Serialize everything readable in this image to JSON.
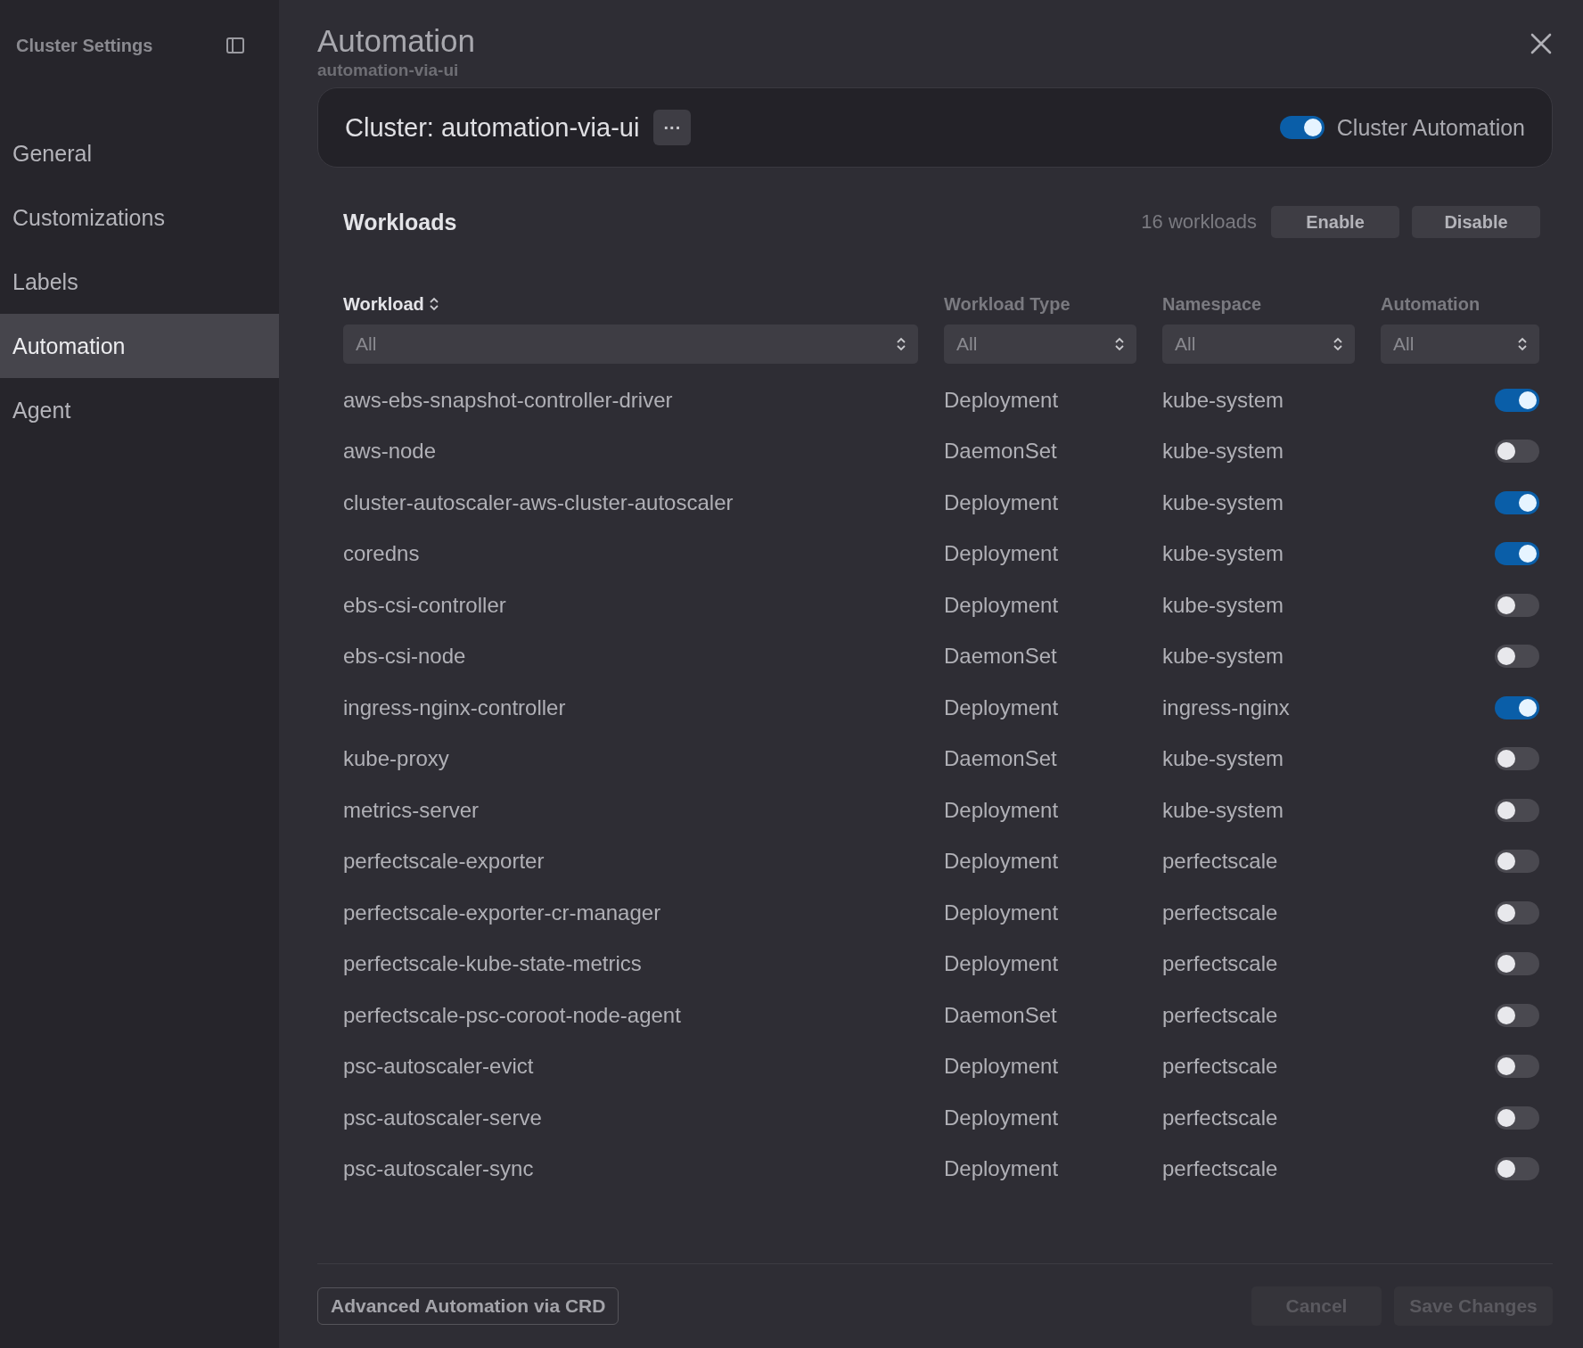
{
  "sidebar": {
    "title": "Cluster Settings",
    "items": [
      {
        "label": "General",
        "selected": false
      },
      {
        "label": "Customizations",
        "selected": false
      },
      {
        "label": "Labels",
        "selected": false
      },
      {
        "label": "Automation",
        "selected": true
      },
      {
        "label": "Agent",
        "selected": false
      }
    ]
  },
  "header": {
    "title": "Automation",
    "subtitle": "automation-via-ui"
  },
  "cluster_card": {
    "title": "Cluster: automation-via-ui",
    "more_button": "···",
    "toggle": {
      "label": "Cluster Automation",
      "on": true
    }
  },
  "workloads": {
    "title": "Workloads",
    "count": "16 workloads",
    "buttons": [
      "Enable",
      "Disable"
    ],
    "columns": [
      {
        "label": "Workload",
        "sortable": true,
        "filter": "All"
      },
      {
        "label": "Workload Type",
        "sortable": false,
        "filter": "All"
      },
      {
        "label": "Namespace",
        "sortable": false,
        "filter": "All"
      },
      {
        "label": "Automation",
        "sortable": false,
        "filter": "All"
      }
    ],
    "rows": [
      {
        "name": "aws-ebs-snapshot-controller-driver",
        "type": "Deployment",
        "namespace": "kube-system",
        "on": true
      },
      {
        "name": "aws-node",
        "type": "DaemonSet",
        "namespace": "kube-system",
        "on": false
      },
      {
        "name": "cluster-autoscaler-aws-cluster-autoscaler",
        "type": "Deployment",
        "namespace": "kube-system",
        "on": true
      },
      {
        "name": "coredns",
        "type": "Deployment",
        "namespace": "kube-system",
        "on": true
      },
      {
        "name": "ebs-csi-controller",
        "type": "Deployment",
        "namespace": "kube-system",
        "on": false
      },
      {
        "name": "ebs-csi-node",
        "type": "DaemonSet",
        "namespace": "kube-system",
        "on": false
      },
      {
        "name": "ingress-nginx-controller",
        "type": "Deployment",
        "namespace": "ingress-nginx",
        "on": true
      },
      {
        "name": "kube-proxy",
        "type": "DaemonSet",
        "namespace": "kube-system",
        "on": false
      },
      {
        "name": "metrics-server",
        "type": "Deployment",
        "namespace": "kube-system",
        "on": false
      },
      {
        "name": "perfectscale-exporter",
        "type": "Deployment",
        "namespace": "perfectscale",
        "on": false
      },
      {
        "name": "perfectscale-exporter-cr-manager",
        "type": "Deployment",
        "namespace": "perfectscale",
        "on": false
      },
      {
        "name": "perfectscale-kube-state-metrics",
        "type": "Deployment",
        "namespace": "perfectscale",
        "on": false
      },
      {
        "name": "perfectscale-psc-coroot-node-agent",
        "type": "DaemonSet",
        "namespace": "perfectscale",
        "on": false
      },
      {
        "name": "psc-autoscaler-evict",
        "type": "Deployment",
        "namespace": "perfectscale",
        "on": false
      },
      {
        "name": "psc-autoscaler-serve",
        "type": "Deployment",
        "namespace": "perfectscale",
        "on": false
      },
      {
        "name": "psc-autoscaler-sync",
        "type": "Deployment",
        "namespace": "perfectscale",
        "on": false
      }
    ]
  },
  "footer": {
    "link_button": "Advanced Automation via CRD",
    "buttons": [
      {
        "label": "Cancel",
        "disabled": true
      },
      {
        "label": "Save Changes",
        "disabled": true
      }
    ]
  }
}
